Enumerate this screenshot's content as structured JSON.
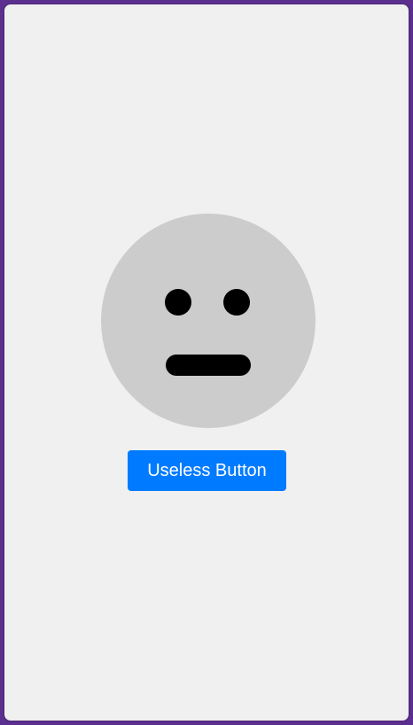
{
  "face": {
    "expression": "neutral-face",
    "colors": {
      "face": "#cccccc",
      "features": "#000000"
    }
  },
  "button": {
    "label": "Useless Button",
    "background": "#007bff",
    "text_color": "#ffffff"
  },
  "colors": {
    "page_bg": "#f0f0f0",
    "frame_border": "#5b2f8e"
  }
}
